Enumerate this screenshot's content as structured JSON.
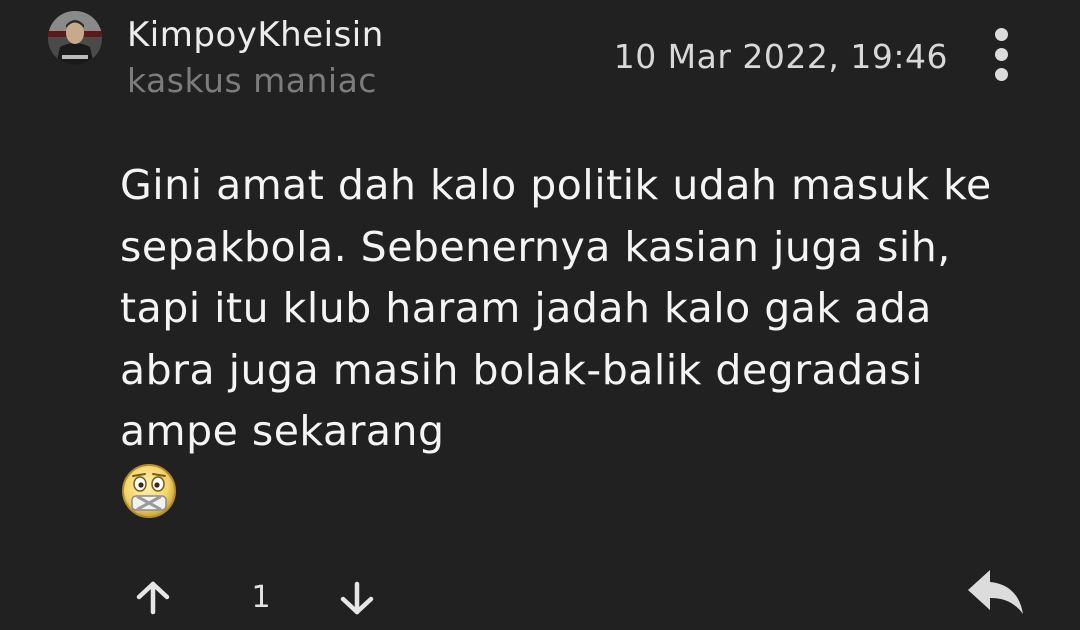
{
  "post": {
    "author": {
      "username": "KimpoyKheisin",
      "rank": "kaskus maniac",
      "avatar_icon": "avatar-image"
    },
    "timestamp": "10 Mar 2022, 19:46",
    "body": "Gini amat dah kalo politik udah masuk ke sepakbola. Sebenernya kasian juga sih, tapi itu klub haram jadah kalo gak ada abra juga masih bolak-balik degradasi ampe sekarang",
    "emoji": "emoticon-smiley-icon",
    "vote_count": "1",
    "icons": {
      "more": "more-vertical-icon",
      "upvote": "arrow-up-icon",
      "downvote": "arrow-down-icon",
      "reply": "reply-icon"
    }
  },
  "colors": {
    "background": "#212121",
    "text": "#f4f4f4",
    "muted": "#7c7c7c"
  }
}
